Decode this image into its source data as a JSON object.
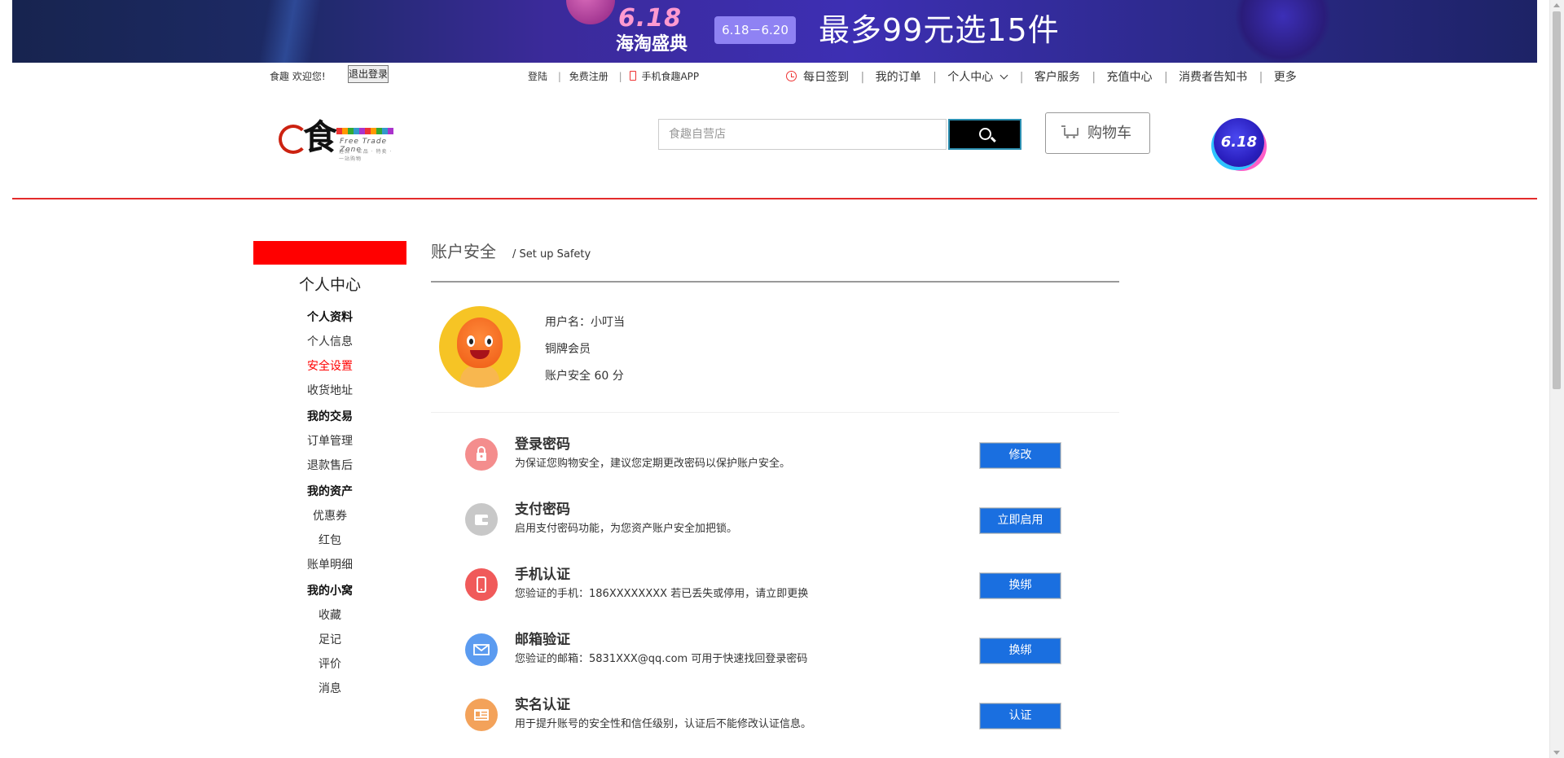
{
  "banner": {
    "event": "6.18",
    "title": "海淘盛典",
    "dates": "6.18－6.20",
    "slogan": "最多99元选15件"
  },
  "topbar": {
    "welcome": "食趣 欢迎您!",
    "logout": "退出登录",
    "login": "登陆",
    "register": "免费注册",
    "app": "手机食趣APP",
    "checkin": "每日签到",
    "orders": "我的订单",
    "personal": "个人中心",
    "service": "客户服务",
    "recharge": "充值中心",
    "notice": "消费者告知书",
    "more": "更多",
    "separator": "|"
  },
  "header": {
    "logo_char": "食",
    "logo_sub": "Free Trade Zone",
    "logo_tag": "进口 · 正品 · 特卖 · 一站购物",
    "search_placeholder": "食趣自营店",
    "cart_label": "购物车",
    "badge": "6.18"
  },
  "sidebar": {
    "title": "个人中心",
    "groups": [
      {
        "title": "个人资料",
        "items": [
          "个人信息",
          "安全设置",
          "收货地址"
        ]
      },
      {
        "title": "我的交易",
        "items": [
          "订单管理",
          "退款售后"
        ]
      },
      {
        "title": "我的资产",
        "items": [
          "优惠券",
          "红包",
          "账单明细"
        ]
      },
      {
        "title": "我的小窝",
        "items": [
          "收藏",
          "足记",
          "评价",
          "消息"
        ]
      }
    ],
    "active": "安全设置"
  },
  "main": {
    "title": "账户安全",
    "subtitle": "/ Set up Safety",
    "username": "用户名：小叮当",
    "level": "铜牌会员",
    "score": "账户安全 60 分",
    "rows": [
      {
        "title": "登录密码",
        "desc": "为保证您购物安全，建议您定期更改密码以保护账户安全。",
        "button": "修改",
        "icon": "lock-icon",
        "color": "#f48d8d"
      },
      {
        "title": "支付密码",
        "desc": "启用支付密码功能，为您资产账户安全加把锁。",
        "button": "立即启用",
        "icon": "wallet-icon",
        "color": "#c8c8c8"
      },
      {
        "title": "手机认证",
        "desc": "您验证的手机：186XXXXXXXX 若已丢失或停用，请立即更换",
        "button": "换绑",
        "icon": "phone-icon",
        "color": "#f05a5a"
      },
      {
        "title": "邮箱验证",
        "desc": "您验证的邮箱：5831XXX@qq.com 可用于快速找回登录密码",
        "button": "换绑",
        "icon": "mail-icon",
        "color": "#5b9bf0"
      },
      {
        "title": "实名认证",
        "desc": "用于提升账号的安全性和信任级别，认证后不能修改认证信息。",
        "button": "认证",
        "icon": "id-card-icon",
        "color": "#f3a25a"
      }
    ]
  }
}
